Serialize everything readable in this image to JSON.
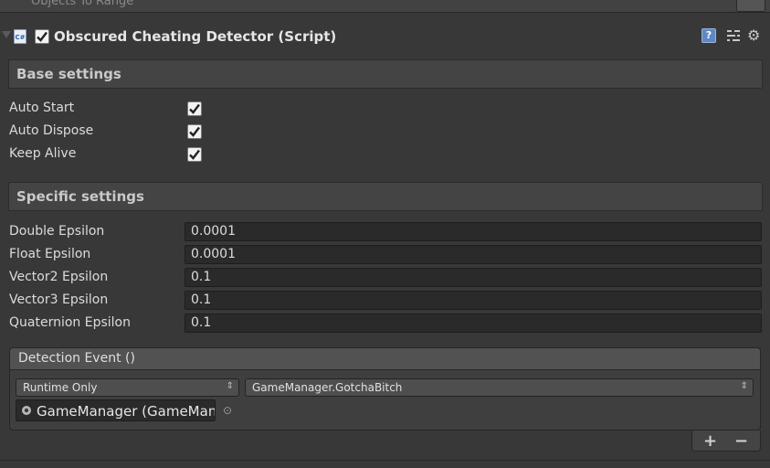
{
  "previous_component": {
    "label": "Objects To Range"
  },
  "header": {
    "title": "Obscured Cheating Detector (Script)",
    "enabled": true,
    "script_icon_text": "C#",
    "help_icon_text": "?"
  },
  "sections": {
    "base": {
      "title": "Base settings",
      "items": [
        {
          "label": "Auto Start",
          "checked": true
        },
        {
          "label": "Auto Dispose",
          "checked": true
        },
        {
          "label": "Keep Alive",
          "checked": true
        }
      ]
    },
    "specific": {
      "title": "Specific settings",
      "fields": [
        {
          "label": "Double Epsilon",
          "value": "0.0001"
        },
        {
          "label": "Float Epsilon",
          "value": "0.0001"
        },
        {
          "label": "Vector2 Epsilon",
          "value": "0.1"
        },
        {
          "label": "Vector3 Epsilon",
          "value": "0.1"
        },
        {
          "label": "Quaternion Epsilon",
          "value": "0.1"
        }
      ]
    }
  },
  "event": {
    "title": "Detection Event ()",
    "runtime_dropdown": "Runtime Only",
    "function_dropdown": "GameManager.GotchaBitch",
    "object_field": "GameManager (GameMana",
    "add_label": "+",
    "remove_label": "−"
  },
  "colors": {
    "background": "#383838",
    "field": "#2a2a2a",
    "accent": "#5e87c4"
  }
}
